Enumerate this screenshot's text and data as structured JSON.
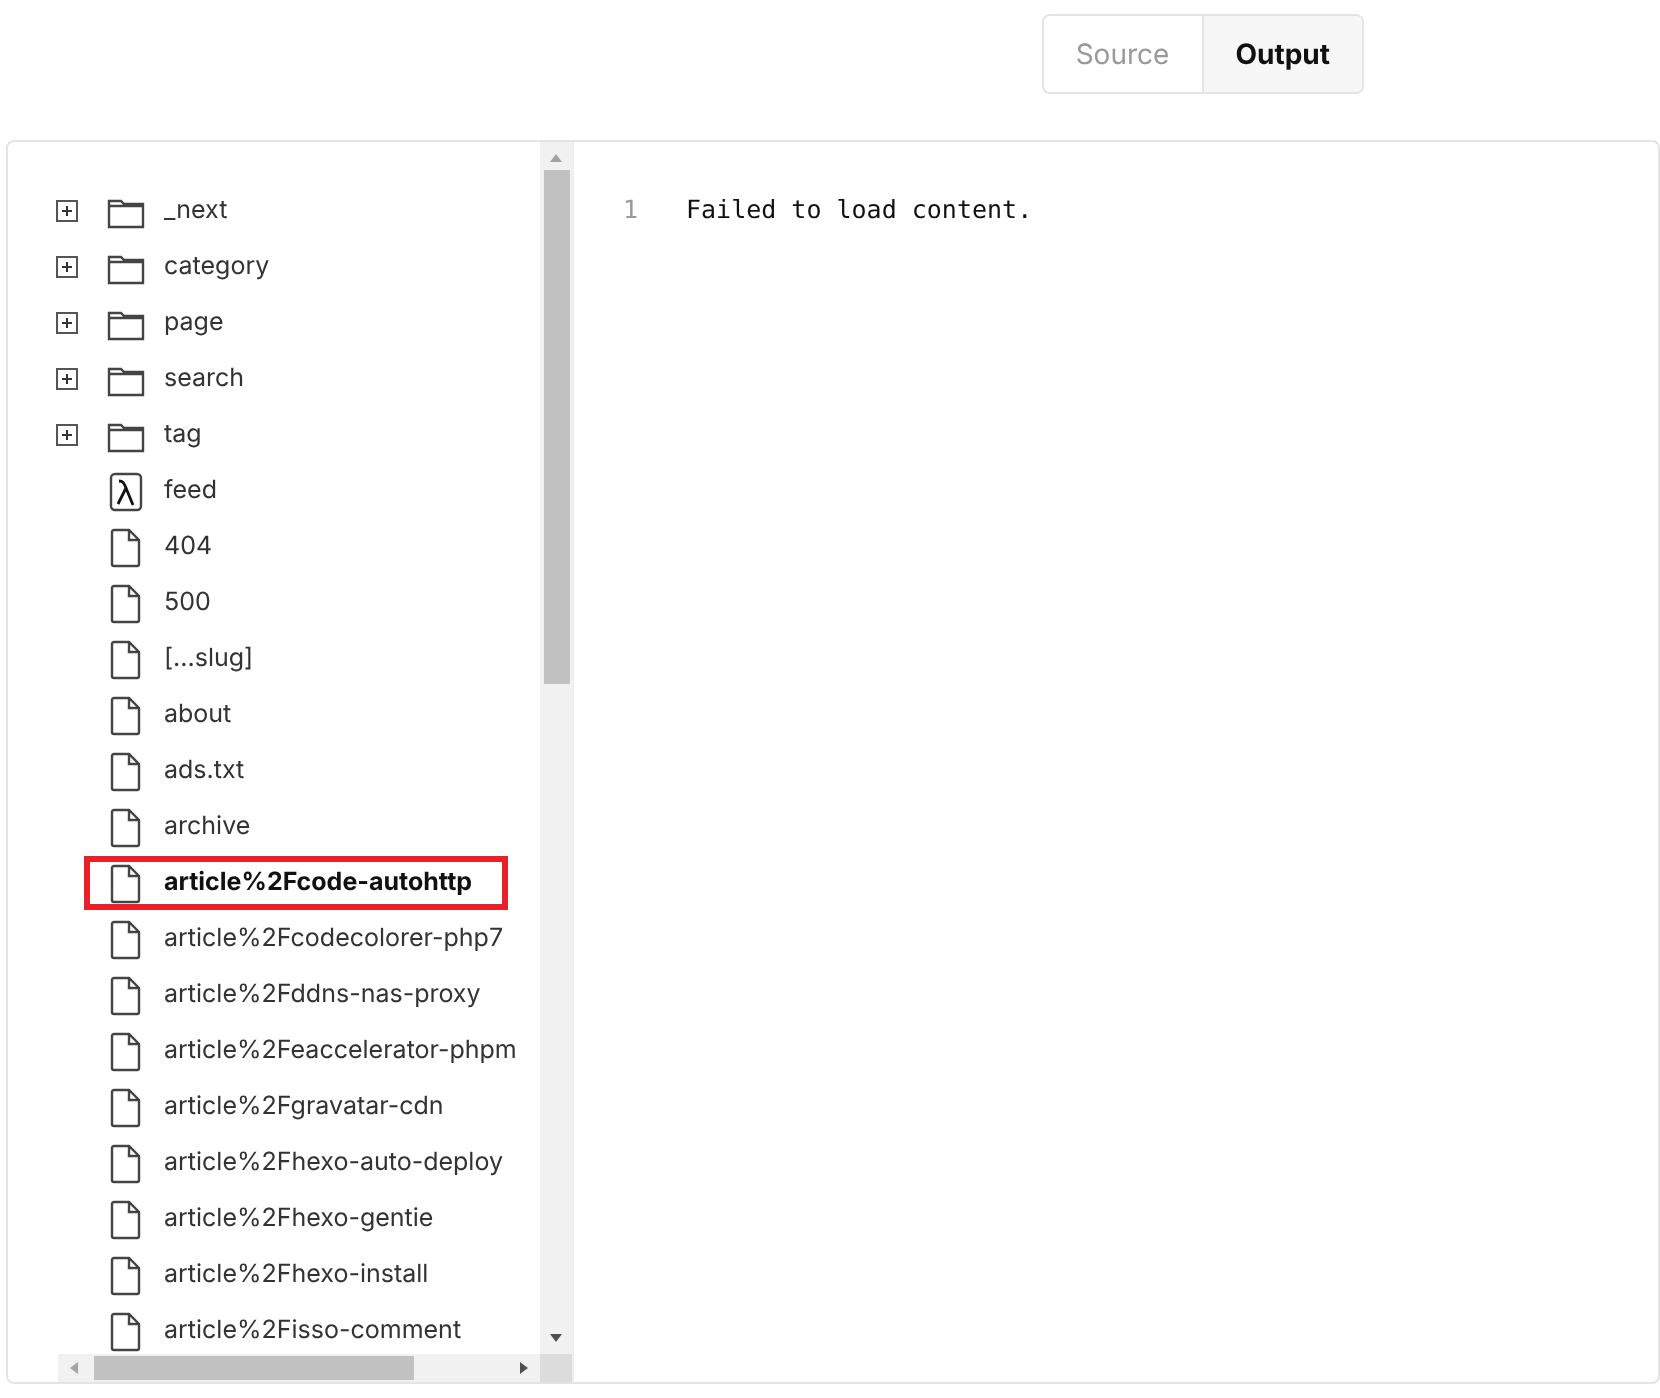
{
  "tabs": [
    {
      "label": "Source",
      "selected": false
    },
    {
      "label": "Output",
      "selected": true
    }
  ],
  "tree": [
    {
      "kind": "folder",
      "label": "_next",
      "expanded": false,
      "selected": false
    },
    {
      "kind": "folder",
      "label": "category",
      "expanded": false,
      "selected": false
    },
    {
      "kind": "folder",
      "label": "page",
      "expanded": false,
      "selected": false
    },
    {
      "kind": "folder",
      "label": "search",
      "expanded": false,
      "selected": false
    },
    {
      "kind": "folder",
      "label": "tag",
      "expanded": false,
      "selected": false
    },
    {
      "kind": "lambda",
      "label": "feed",
      "selected": false
    },
    {
      "kind": "file",
      "label": "404",
      "selected": false
    },
    {
      "kind": "file",
      "label": "500",
      "selected": false
    },
    {
      "kind": "file",
      "label": "[...slug]",
      "selected": false
    },
    {
      "kind": "file",
      "label": "about",
      "selected": false
    },
    {
      "kind": "file",
      "label": "ads.txt",
      "selected": false
    },
    {
      "kind": "file",
      "label": "archive",
      "selected": false
    },
    {
      "kind": "file",
      "label": "article%2Fcode-autohttp",
      "selected": true
    },
    {
      "kind": "file",
      "label": "article%2Fcodecolorer-php7",
      "selected": false
    },
    {
      "kind": "file",
      "label": "article%2Fddns-nas-proxy",
      "selected": false
    },
    {
      "kind": "file",
      "label": "article%2Feaccelerator-phpm",
      "selected": false
    },
    {
      "kind": "file",
      "label": "article%2Fgravatar-cdn",
      "selected": false
    },
    {
      "kind": "file",
      "label": "article%2Fhexo-auto-deploy",
      "selected": false
    },
    {
      "kind": "file",
      "label": "article%2Fhexo-gentie",
      "selected": false
    },
    {
      "kind": "file",
      "label": "article%2Fhexo-install",
      "selected": false
    },
    {
      "kind": "file",
      "label": "article%2Fisso-comment",
      "selected": false
    }
  ],
  "editor": {
    "lines": [
      {
        "number": "1",
        "text": "Failed to load content."
      }
    ]
  }
}
